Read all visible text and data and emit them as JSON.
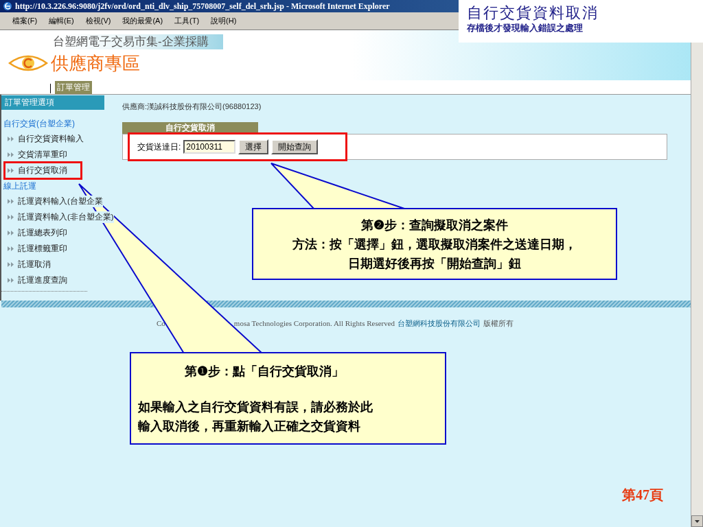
{
  "slide": {
    "title": "自行交貨資料取消",
    "subtitle": "存檔後才發現輸入錯誤之處理",
    "page_number": "第47頁"
  },
  "browser": {
    "title": "http://10.3.226.96:9080/j2fv/ord/ord_nti_dlv_ship_75708007_self_del_srh.jsp - Microsoft Internet Explorer",
    "menu": [
      "檔案(F)",
      "編輯(E)",
      "檢視(V)",
      "我的最愛(A)",
      "工具(T)",
      "說明(H)"
    ]
  },
  "site": {
    "market_title": "台塑網電子交易市集-企業採購",
    "zone_title": "供應商專區",
    "tabs": [
      {
        "label": "訂單管理",
        "selected": true
      }
    ]
  },
  "sidebar": {
    "title": "訂單管理選項",
    "sections": [
      {
        "label": "自行交貨(台塑企業)",
        "items": [
          {
            "label": "自行交貨資料輸入",
            "highlighted": false
          },
          {
            "label": "交貨清單重印",
            "highlighted": false
          },
          {
            "label": "自行交貨取消",
            "highlighted": true
          }
        ]
      },
      {
        "label": "線上託運",
        "items": [
          {
            "label": "託運資料輸入(台塑企業",
            "highlighted": false
          },
          {
            "label": "託運資料輸入(非台塑企業)",
            "highlighted": false
          },
          {
            "label": "託運總表列印",
            "highlighted": false
          },
          {
            "label": "託運標籤重印",
            "highlighted": false
          },
          {
            "label": "託運取消",
            "highlighted": false
          },
          {
            "label": "託運進度查詢",
            "highlighted": false
          }
        ]
      }
    ]
  },
  "main": {
    "supplier": "供應商:漢誠科技股份有限公司(96880123)",
    "panel_title": "自行交貨取消",
    "date_label": "交貨送達日:",
    "date_value": "20100311",
    "buttons": [
      "選擇",
      "開始查詢"
    ],
    "highlighted": true
  },
  "footer": {
    "left": "Co",
    "right": "mosa Technologies Corporation. All Rights Reserved",
    "company": "台塑網科技股份有限公司",
    "rights": "版權所有"
  },
  "callouts": [
    {
      "title": "第❷步：查詢擬取消之案件",
      "lines": [
        "方法：按「選擇」鈕，選取擬取消案件之送達日期，",
        "日期選好後再按「開始查詢」鈕"
      ]
    },
    {
      "title": "第❶步：點「自行交貨取消」",
      "lines": [
        "如果輸入之自行交貨資料有誤，請必務於此",
        "輸入取消後，再重新輸入正確之交貨資料"
      ]
    }
  ]
}
